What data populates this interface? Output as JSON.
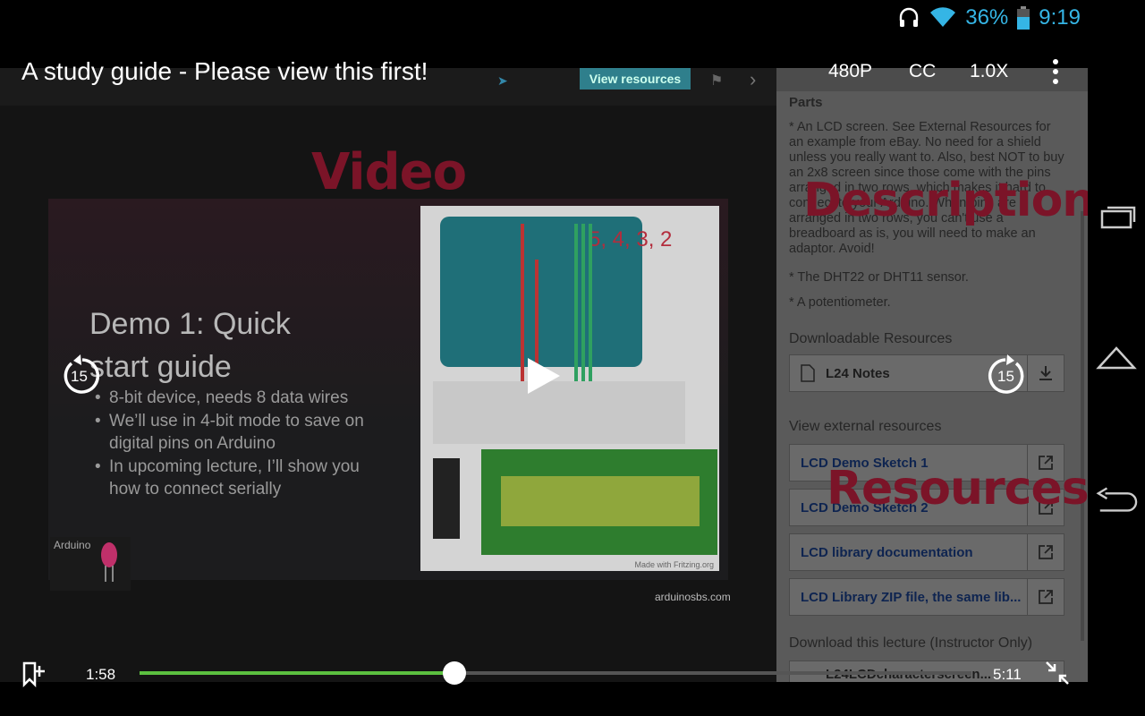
{
  "status_bar": {
    "battery": "36%",
    "time": "9:19"
  },
  "player": {
    "title": "A study guide - Please view this first!",
    "quality": "480P",
    "captions": "CC",
    "speed": "1.0X",
    "skip_back_seconds": "15",
    "skip_forward_seconds": "15",
    "elapsed": "1:58",
    "duration": "5:11",
    "progress_fraction": 0.379,
    "accent_color": "#5cc040"
  },
  "slide": {
    "toolbar_button": "View resources",
    "overlay_label": "Video",
    "heading": "Demo 1: Quick start guide",
    "bullets": [
      "8-bit device, needs 8 data wires",
      "We’ll use in 4-bit mode to save on digital pins on Arduino",
      "In upcoming lecture, I’ll show you how to connect serially"
    ],
    "pins_label": "5, 4, 3, 2",
    "fritzing_credit": "Made with Fritzing.org",
    "badge_text": "Arduino",
    "site": "arduinosbs.com"
  },
  "sidebar": {
    "parts_heading": "Parts",
    "parts_text": "* An LCD screen. See External Resources for an example from eBay. No need for a shield unless you really want to. Also, best NOT to buy an 2x8 screen since those come with the pins arranged in two rows, which makes it hard to connect to your Arduino. When pins are arranged in two rows, you can't use a breadboard as is, you will need to make an adaptor. Avoid!",
    "sensor_text": "* The DHT22 or DHT11 sensor.",
    "pot_text": "* A potentiometer.",
    "downloadable_heading": "Downloadable Resources",
    "downloadable": [
      {
        "label": "L24 Notes",
        "icon": "download-icon"
      }
    ],
    "external_heading": "View external resources",
    "external": [
      {
        "label": "LCD Demo Sketch 1",
        "icon": "external-link-icon"
      },
      {
        "label": "LCD Demo Sketch 2",
        "icon": "external-link-icon"
      },
      {
        "label": "LCD library documentation",
        "icon": "external-link-icon"
      },
      {
        "label": "LCD Library ZIP file, the same lib...",
        "icon": "external-link-icon"
      }
    ],
    "download_lecture_heading": "Download this lecture (Instructor Only)",
    "download_lecture_file": "L24LCDcharacterscreen...",
    "overlay_description": "Description",
    "overlay_resources": "Resources"
  }
}
